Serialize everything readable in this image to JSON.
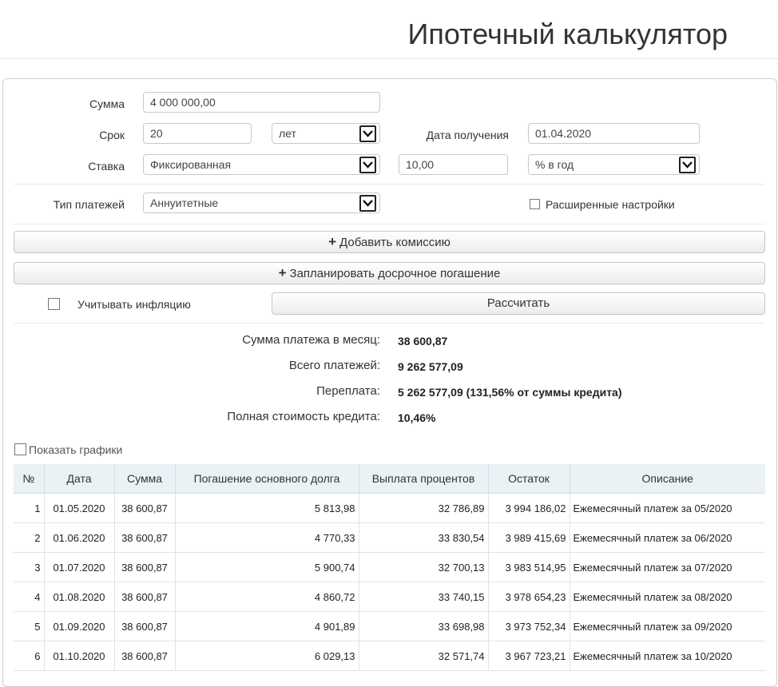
{
  "page": {
    "title": "Ипотечный калькулятор"
  },
  "form": {
    "sum_label": "Сумма",
    "sum_value": "4 000 000,00",
    "term_label": "Срок",
    "term_value": "20",
    "term_unit": "лет",
    "date_label": "Дата получения",
    "date_value": "01.04.2020",
    "rate_label": "Ставка",
    "rate_type": "Фиксированная",
    "rate_value": "10,00",
    "rate_unit": "% в год",
    "payment_type_label": "Тип платежей",
    "payment_type": "Аннуитетные",
    "advanced_label": "Расширенные настройки",
    "add_commission": "Добавить комиссию",
    "plan_prepayment": "Запланировать досрочное погашение",
    "inflation_label": "Учитывать инфляцию",
    "calculate": "Рассчитать"
  },
  "results": {
    "monthly_label": "Сумма платежа в месяц:",
    "monthly_value": "38 600,87",
    "total_label": "Всего платежей:",
    "total_value": "9 262 577,09",
    "overpay_label": "Переплата:",
    "overpay_value": "5 262 577,09 (131,56% от суммы кредита)",
    "full_cost_label": "Полная стоимость кредита:",
    "full_cost_value": "10,46%"
  },
  "charts_toggle_label": "Показать графики",
  "schedule": {
    "headers": [
      "№",
      "Дата",
      "Сумма",
      "Погашение основного долга",
      "Выплата процентов",
      "Остаток",
      "Описание"
    ],
    "rows": [
      [
        "1",
        "01.05.2020",
        "38 600,87",
        "5 813,98",
        "32 786,89",
        "3 994 186,02",
        "Ежемесячный платеж за 05/2020"
      ],
      [
        "2",
        "01.06.2020",
        "38 600,87",
        "4 770,33",
        "33 830,54",
        "3 989 415,69",
        "Ежемесячный платеж за 06/2020"
      ],
      [
        "3",
        "01.07.2020",
        "38 600,87",
        "5 900,74",
        "32 700,13",
        "3 983 514,95",
        "Ежемесячный платеж за 07/2020"
      ],
      [
        "4",
        "01.08.2020",
        "38 600,87",
        "4 860,72",
        "33 740,15",
        "3 978 654,23",
        "Ежемесячный платеж за 08/2020"
      ],
      [
        "5",
        "01.09.2020",
        "38 600,87",
        "4 901,89",
        "33 698,98",
        "3 973 752,34",
        "Ежемесячный платеж за 09/2020"
      ],
      [
        "6",
        "01.10.2020",
        "38 600,87",
        "6 029,13",
        "32 571,74",
        "3 967 723,21",
        "Ежемесячный платеж за 10/2020"
      ]
    ]
  },
  "icons": {
    "dropdown": "chevron-down-icon",
    "add": "plus-icon"
  },
  "colors": {
    "table_header_bg": "#eaf2f6",
    "text": "#222222"
  }
}
